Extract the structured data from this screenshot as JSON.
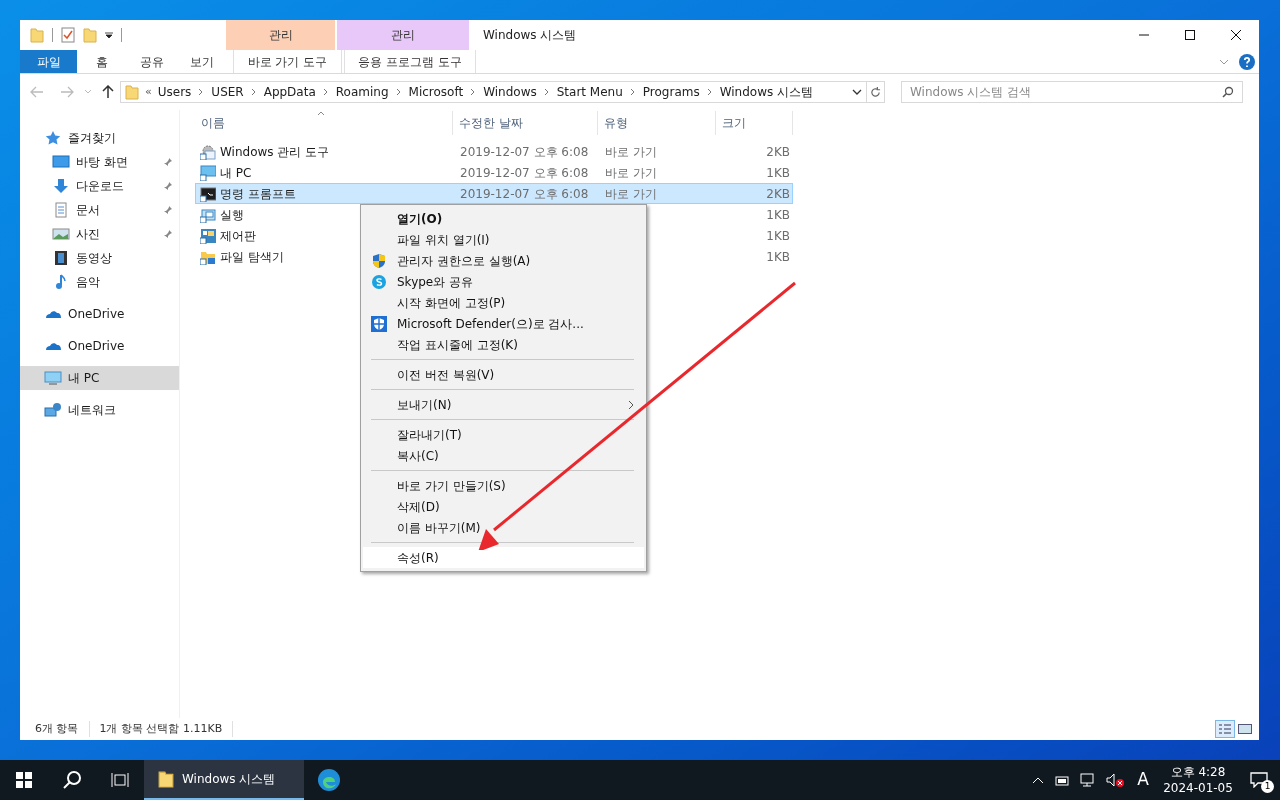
{
  "window": {
    "title": "Windows 시스템"
  },
  "contextual_tabs": [
    {
      "group": "관리",
      "label": "바로 가기 도구",
      "color": "#fdd0b6"
    },
    {
      "group": "관리",
      "label": "응용 프로그램 도구",
      "color": "#e8c8f8"
    }
  ],
  "file_tab": "파일",
  "ribbon_tabs": [
    {
      "label": "홈",
      "selected": false
    },
    {
      "label": "공유",
      "selected": false
    },
    {
      "label": "보기",
      "selected": false
    }
  ],
  "address": {
    "overflow": "«",
    "segments": [
      "Users",
      "USER",
      "AppData",
      "Roaming",
      "Microsoft",
      "Windows",
      "Start Menu",
      "Programs",
      "Windows 시스템"
    ]
  },
  "search": {
    "placeholder": "Windows 시스템 검색"
  },
  "sidebar": [
    {
      "label": "즐겨찾기",
      "kind": "star",
      "selected": false,
      "children": [
        {
          "label": "바탕 화면",
          "kind": "desktop",
          "pinned": true,
          "selected": false
        },
        {
          "label": "다운로드",
          "kind": "download",
          "pinned": true,
          "selected": false
        },
        {
          "label": "문서",
          "kind": "document",
          "pinned": true,
          "selected": false
        },
        {
          "label": "사진",
          "kind": "photo",
          "pinned": true,
          "selected": false
        },
        {
          "label": "동영상",
          "kind": "video",
          "pinned": false,
          "selected": false
        },
        {
          "label": "음악",
          "kind": "music",
          "pinned": false,
          "selected": false
        }
      ]
    },
    {
      "label": "OneDrive",
      "kind": "cloud",
      "selected": false
    },
    {
      "label": "OneDrive",
      "kind": "cloud",
      "selected": false
    },
    {
      "label": "내 PC",
      "kind": "pc",
      "selected": true
    },
    {
      "label": "네트워크",
      "kind": "network",
      "selected": false
    }
  ],
  "table": {
    "columns": [
      "이름",
      "수정한 날짜",
      "유형",
      "크기"
    ],
    "rows": [
      {
        "name": "Windows 관리 도구",
        "kind": "gear",
        "date": "2019-12-07 오후 6:08",
        "type": "바로 가기",
        "size": "2KB",
        "selected": false
      },
      {
        "name": "내 PC",
        "kind": "pc",
        "date": "2019-12-07 오후 6:08",
        "type": "바로 가기",
        "size": "1KB",
        "selected": false
      },
      {
        "name": "명령 프롬프트",
        "kind": "cmd",
        "date": "2019-12-07 오후 6:08",
        "type": "바로 가기",
        "size": "2KB",
        "selected": true
      },
      {
        "name": "실행",
        "kind": "run",
        "size": "1KB",
        "selected": false
      },
      {
        "name": "제어판",
        "kind": "panel",
        "size": "1KB",
        "selected": false
      },
      {
        "name": "파일 탐색기",
        "kind": "folder",
        "size": "1KB",
        "selected": false
      }
    ]
  },
  "context_menu": [
    {
      "kind": "item",
      "label": "열기(O)",
      "bold": true,
      "selected": false
    },
    {
      "kind": "item",
      "label": "파일 위치 열기(I)",
      "selected": false
    },
    {
      "kind": "runas",
      "label": "관리자 권한으로 실행(A)",
      "selected": false
    },
    {
      "kind": "share",
      "label": "Skype와 공유",
      "selected": false
    },
    {
      "kind": "item",
      "label": "시작 화면에 고정(P)",
      "selected": false
    },
    {
      "kind": "scan",
      "label": "Microsoft Defender(으)로 검사...",
      "selected": false
    },
    {
      "kind": "item",
      "label": "작업 표시줄에 고정(K)",
      "selected": false
    },
    {
      "kind": "separator"
    },
    {
      "kind": "item",
      "label": "이전 버전 복원(V)",
      "selected": false
    },
    {
      "kind": "separator"
    },
    {
      "kind": "item",
      "label": "보내기(N)",
      "submenu": true,
      "selected": false
    },
    {
      "kind": "separator"
    },
    {
      "kind": "item",
      "label": "잘라내기(T)",
      "selected": false
    },
    {
      "kind": "item",
      "label": "복사(C)",
      "selected": false
    },
    {
      "kind": "separator"
    },
    {
      "kind": "item",
      "label": "바로 가기 만들기(S)",
      "selected": false
    },
    {
      "kind": "item",
      "label": "삭제(D)",
      "selected": false
    },
    {
      "kind": "item",
      "label": "이름 바꾸기(M)",
      "selected": false
    },
    {
      "kind": "separator"
    },
    {
      "kind": "item",
      "label": "속성(R)",
      "selected": true
    }
  ],
  "status_bar": {
    "count": "6개 항목",
    "selection": "1개 항목 선택함 1.11KB"
  },
  "taskbar": {
    "app": {
      "label": "Windows 시스템",
      "selected": true
    },
    "ime": "A",
    "time": "오후 4:28",
    "date": "2024-01-05",
    "notifications": "1"
  }
}
